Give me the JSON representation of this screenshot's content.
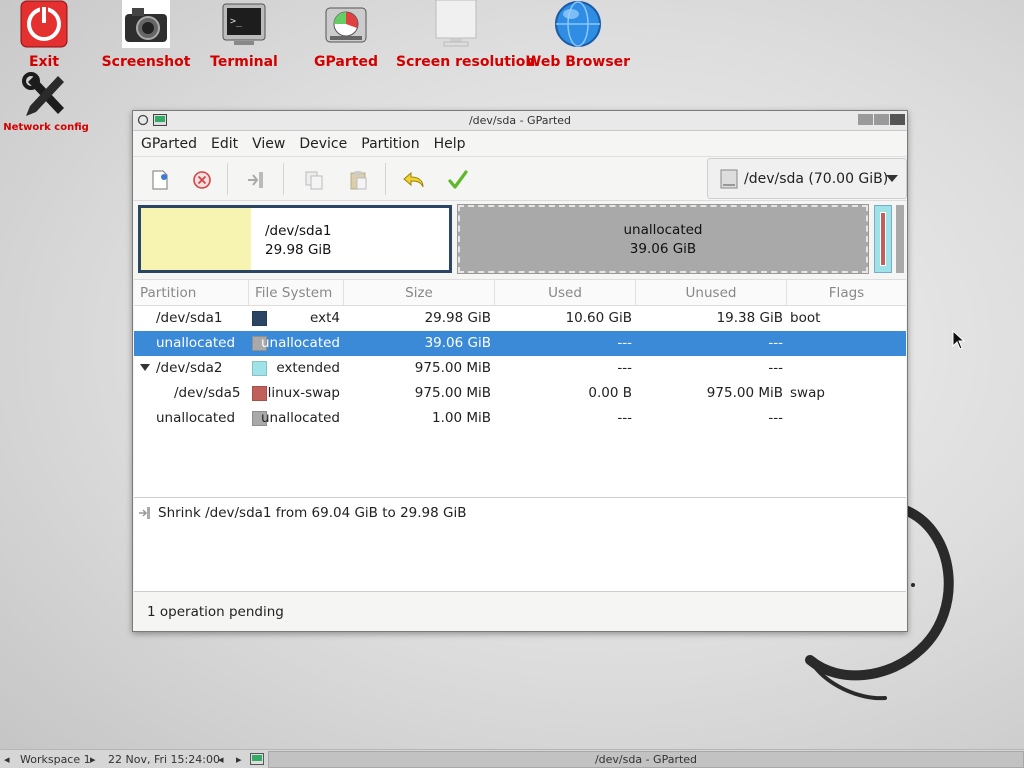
{
  "desktop": {
    "icons": [
      {
        "label": "Exit",
        "icon": "power-icon"
      },
      {
        "label": "Screenshot",
        "icon": "camera-icon"
      },
      {
        "label": "Terminal",
        "icon": "terminal-icon"
      },
      {
        "label": "GParted",
        "icon": "gparted-icon"
      },
      {
        "label": "Screen resolution",
        "icon": "monitor-icon"
      },
      {
        "label": "Web Browser",
        "icon": "globe-icon"
      },
      {
        "label": "Network config",
        "icon": "wrench-icon"
      }
    ]
  },
  "window": {
    "title": "/dev/sda - GParted",
    "menu": [
      "GParted",
      "Edit",
      "View",
      "Device",
      "Partition",
      "Help"
    ],
    "toolbar": {
      "buttons": [
        "new-partition-icon",
        "delete-icon",
        "resize-move-icon",
        "copy-icon",
        "paste-icon",
        "undo-icon",
        "apply-icon"
      ]
    },
    "device_selector": "/dev/sda (70.00 GiB)",
    "diskmap": {
      "seg1_name": "/dev/sda1",
      "seg1_size": "29.98 GiB",
      "seg2_name": "unallocated",
      "seg2_size": "39.06 GiB"
    },
    "columns": [
      "Partition",
      "File System",
      "Size",
      "Used",
      "Unused",
      "Flags"
    ],
    "rows": [
      {
        "partition": "/dev/sda1",
        "color": "#2b4564",
        "fs": "ext4",
        "size": "29.98 GiB",
        "used": "10.60 GiB",
        "unused": "19.38 GiB",
        "flags": "boot"
      },
      {
        "partition": "unallocated",
        "color": "#a9a9a9",
        "fs": "unallocated",
        "size": "39.06 GiB",
        "used": "---",
        "unused": "---",
        "flags": ""
      },
      {
        "partition": "/dev/sda2",
        "color": "#9fe3e8",
        "fs": "extended",
        "size": "975.00 MiB",
        "used": "---",
        "unused": "---",
        "flags": ""
      },
      {
        "partition": "/dev/sda5",
        "color": "#c1605a",
        "fs": "linux-swap",
        "size": "975.00 MiB",
        "used": "0.00 B",
        "unused": "975.00 MiB",
        "flags": "swap"
      },
      {
        "partition": "unallocated",
        "color": "#a9a9a9",
        "fs": "unallocated",
        "size": "1.00 MiB",
        "used": "---",
        "unused": "---",
        "flags": ""
      }
    ],
    "operations": [
      "Shrink /dev/sda1 from 69.04 GiB to 29.98 GiB"
    ],
    "status": "1 operation pending"
  },
  "taskbar": {
    "workspace": "Workspace 1",
    "clock": "22 Nov, Fri 15:24:00",
    "task_title": "/dev/sda - GParted"
  },
  "colors": {
    "label_red": "#d40000",
    "selection": "#3b8ad8"
  }
}
